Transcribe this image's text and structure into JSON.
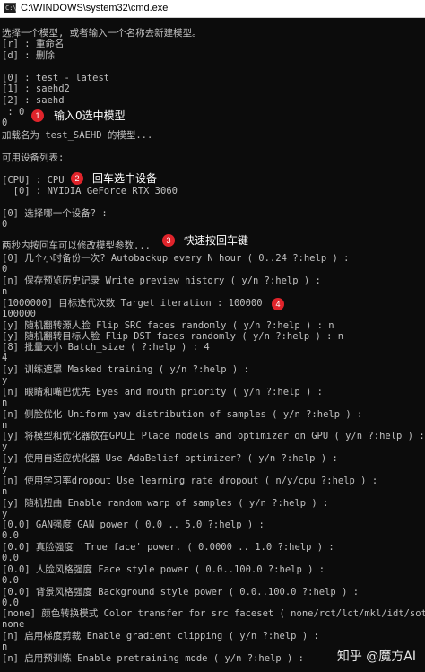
{
  "window": {
    "title": "C:\\WINDOWS\\system32\\cmd.exe",
    "icon": "cmd-icon",
    "icon_text": "C:\\"
  },
  "console": {
    "lines": [
      "选择一个模型, 或者输入一个名称去新建模型。",
      "[r] : 重命名",
      "[d] : 删除",
      "",
      "[0] : test - latest",
      "[1] : saehd2",
      "[2] : saehd",
      " : 0",
      "0",
      "加载名为 test_SAEHD 的模型...",
      "",
      "可用设备列表:",
      "",
      "[CPU] : CPU",
      "  [0] : NVIDIA GeForce RTX 3060",
      "",
      "[0] 选择哪一个设备? :",
      "0",
      "两秒内按回车可以修改模型参数...",
      "[0] 几个小时备份一次? Autobackup every N hour ( 0..24 ?:help ) :",
      "0",
      "[n] 保存预览历史记录 Write preview history ( y/n ?:help ) :",
      "n",
      "[1000000] 目标迭代次数 Target iteration : 100000",
      "100000",
      "[y] 随机翻转源人脸 Flip SRC faces randomly ( y/n ?:help ) : n",
      "[y] 随机翻转目标人脸 Flip DST faces randomly ( y/n ?:help ) : n",
      "[8] 批量大小 Batch_size ( ?:help ) : 4",
      "4",
      "[y] 训练遮罩 Masked training ( y/n ?:help ) :",
      "y",
      "[n] 眼睛和嘴巴优先 Eyes and mouth priority ( y/n ?:help ) :",
      "n",
      "[n] 侧脸优化 Uniform yaw distribution of samples ( y/n ?:help ) :",
      "n",
      "[y] 将模型和优化器放在GPU上 Place models and optimizer on GPU ( y/n ?:help ) :",
      "y",
      "[y] 使用自适应优化器 Use AdaBelief optimizer? ( y/n ?:help ) :",
      "y",
      "[n] 使用学习率dropout Use learning rate dropout ( n/y/cpu ?:help ) :",
      "n",
      "[y] 随机扭曲 Enable random warp of samples ( y/n ?:help ) :",
      "y",
      "[0.0] GAN强度 GAN power ( 0.0 .. 5.0 ?:help ) :",
      "0.0",
      "[0.0] 真脸强度 'True face' power. ( 0.0000 .. 1.0 ?:help ) :",
      "0.0",
      "[0.0] 人脸风格强度 Face style power ( 0.0..100.0 ?:help ) :",
      "0.0",
      "[0.0] 背景风格强度 Background style power ( 0.0..100.0 ?:help ) :",
      "0.0",
      "[none] 颜色转换模式 Color transfer for src faceset ( none/rct/lct/mkl/idt/sot ?:help ) :",
      "none",
      "[n] 启用梯度剪裁 Enable gradient clipping ( y/n ?:help ) :",
      "n",
      "[n] 启用预训练 Enable pretraining mode ( y/n ?:help ) :"
    ]
  },
  "annotations": [
    {
      "number": "1",
      "text": "输入0选中模型"
    },
    {
      "number": "2",
      "text": "回车选中设备"
    },
    {
      "number": "3",
      "text": "快速按回车键"
    },
    {
      "number": "4",
      "text": ""
    }
  ],
  "watermark": "知乎 @魔方AI",
  "colors": {
    "background": "#0c0c0c",
    "text": "#c0c0c0",
    "badge": "#e0242b",
    "titlebar": "#ffffff"
  }
}
